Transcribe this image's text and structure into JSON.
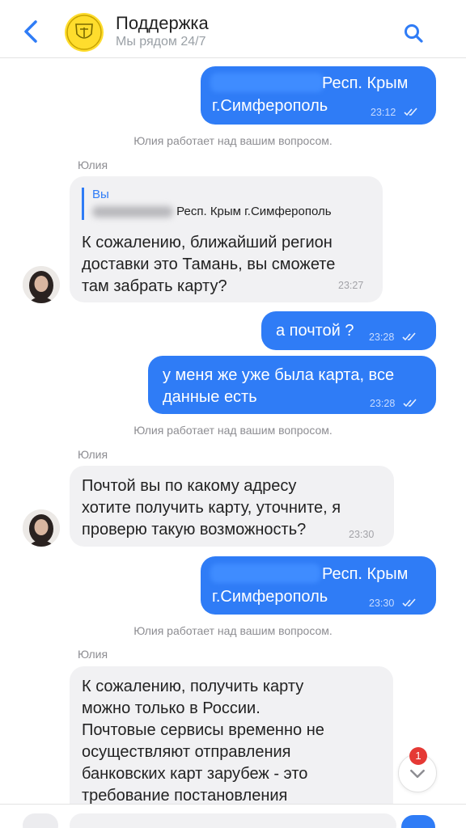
{
  "header": {
    "title": "Поддержка",
    "subtitle": "Мы рядом 24/7"
  },
  "messages": [
    {
      "type": "out",
      "lines": [
        "Респ. Крым",
        "г.Симферополь"
      ],
      "time": "23:12"
    },
    {
      "type": "status",
      "text": "Юлия работает над вашим вопросом."
    },
    {
      "type": "sender",
      "text": "Юлия"
    },
    {
      "type": "in",
      "reply_label": "Вы",
      "reply_text": "Респ. Крым г.Симферополь",
      "lines": [
        "К сожалению, ближайший регион",
        "доставки это Тамань, вы сможете",
        "там забрать карту?"
      ],
      "time": "23:27"
    },
    {
      "type": "out",
      "lines": [
        "а почтой ?"
      ],
      "time": "23:28"
    },
    {
      "type": "out",
      "lines": [
        "у меня же уже была карта, все",
        "данные есть"
      ],
      "time": "23:28"
    },
    {
      "type": "status",
      "text": "Юлия работает над вашим вопросом."
    },
    {
      "type": "sender",
      "text": "Юлия"
    },
    {
      "type": "in",
      "lines": [
        "Почтой вы по какому адресу",
        "хотите получить карту, уточните, я",
        "проверю такую возможность?"
      ],
      "time": "23:30"
    },
    {
      "type": "out",
      "lines": [
        "Респ. Крым",
        "г.Симферополь"
      ],
      "time": "23:30"
    },
    {
      "type": "status",
      "text": "Юлия работает над вашим вопросом."
    },
    {
      "type": "sender",
      "text": "Юлия"
    },
    {
      "type": "in",
      "lines": [
        "К сожалению, получить карту",
        "можно только в России.",
        "Почтовые сервисы временно не",
        "осуществляют отправления",
        "банковских карт зарубеж - это",
        "требование постановления"
      ]
    }
  ],
  "unread_count": "1",
  "icons": {
    "back": "chevron-left-icon",
    "search": "search-icon",
    "scroll_down": "chevron-down-icon",
    "read": "double-check-icon"
  },
  "colors": {
    "accent": "#2f7cf6",
    "incoming_bubble": "#f1f1f3",
    "badge": "#e53935",
    "logo": "#ffdd2d"
  }
}
